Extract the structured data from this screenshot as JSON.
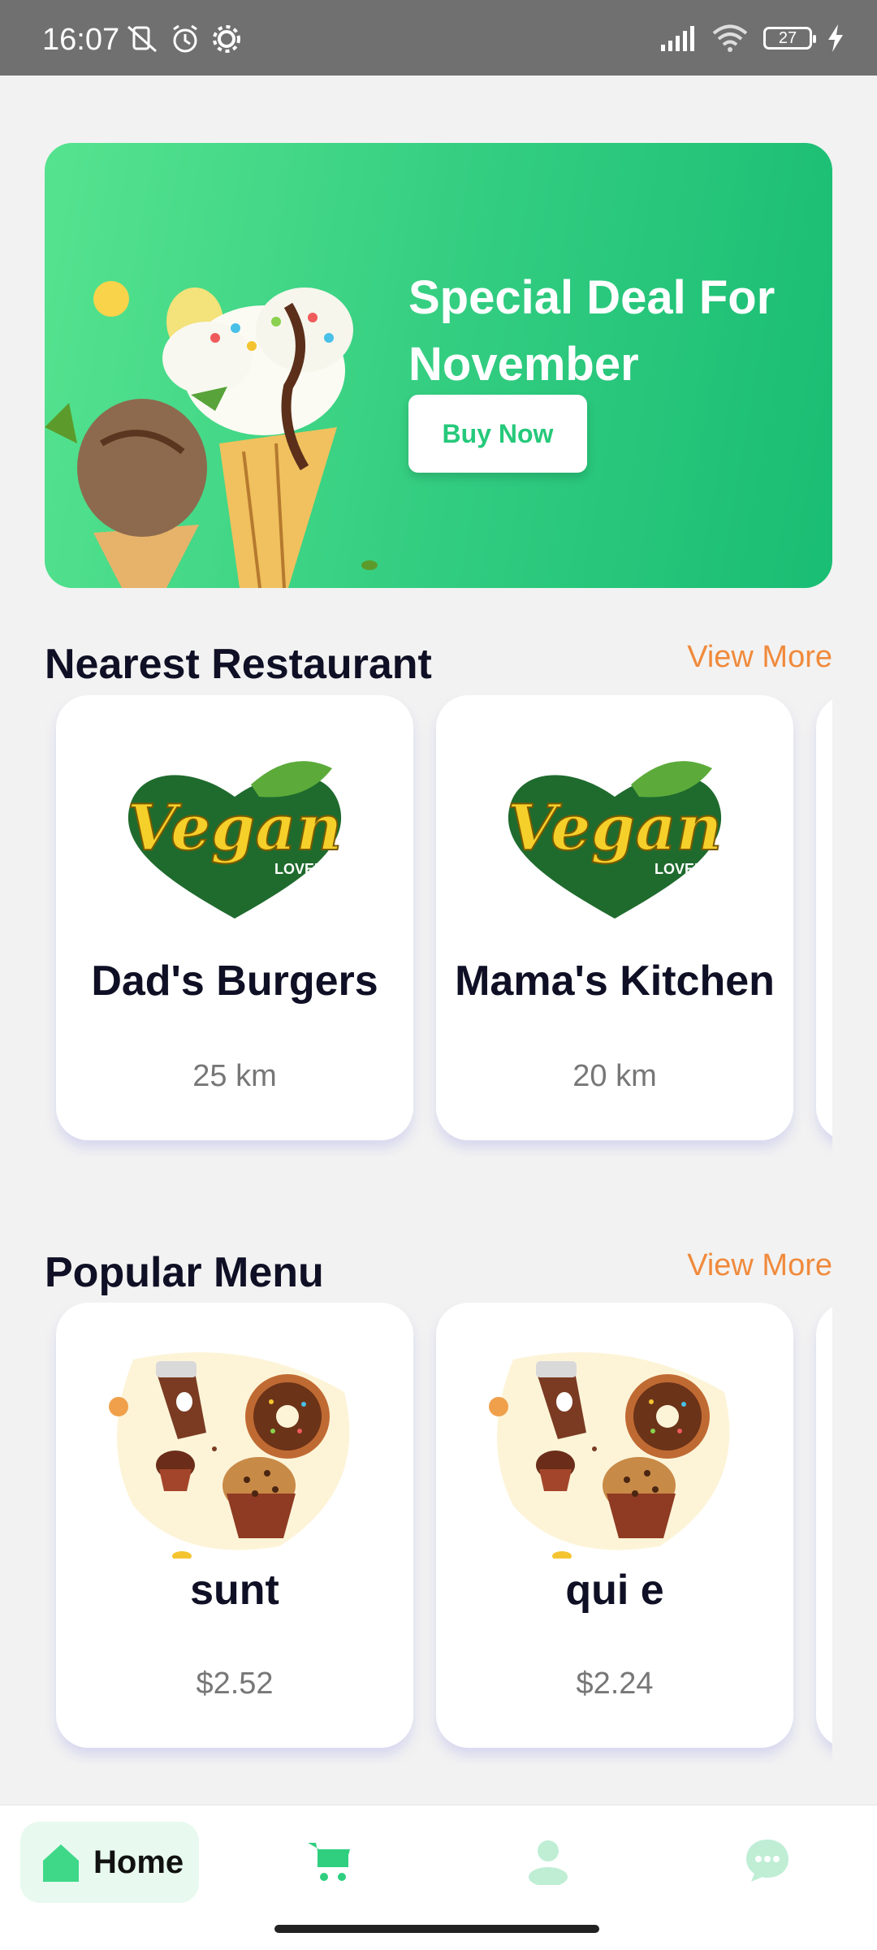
{
  "status_bar": {
    "time": "16:07",
    "battery": "27",
    "icons": [
      "mute-vibrate-icon",
      "alarm-icon",
      "settings-icon",
      "signal-icon",
      "wifi-icon",
      "battery-icon",
      "charging-icon"
    ]
  },
  "banner": {
    "title": "Special Deal For November",
    "button_label": "Buy Now"
  },
  "nearest_restaurant": {
    "title": "Nearest Restaurant",
    "view_more": "View More",
    "items": [
      {
        "name": "Dad's Burgers",
        "distance": "25 km",
        "logo_text": "Vegan",
        "logo_sub": "LOVER"
      },
      {
        "name": "Mama's Kitchen",
        "distance": "20 km",
        "logo_text": "Vegan",
        "logo_sub": "LOVER"
      }
    ]
  },
  "popular_menu": {
    "title": "Popular Menu",
    "view_more": "View More",
    "items": [
      {
        "name": "sunt",
        "price": "$2.52"
      },
      {
        "name": "qui e",
        "price": "$2.24"
      }
    ]
  },
  "bottom_nav": {
    "home_label": "Home",
    "items": [
      "home-icon",
      "cart-icon",
      "profile-icon",
      "chat-icon"
    ]
  },
  "colors": {
    "accent_green": "#2ecc80",
    "view_more_orange": "#f08a3c",
    "text_dark": "#0f0f25"
  }
}
